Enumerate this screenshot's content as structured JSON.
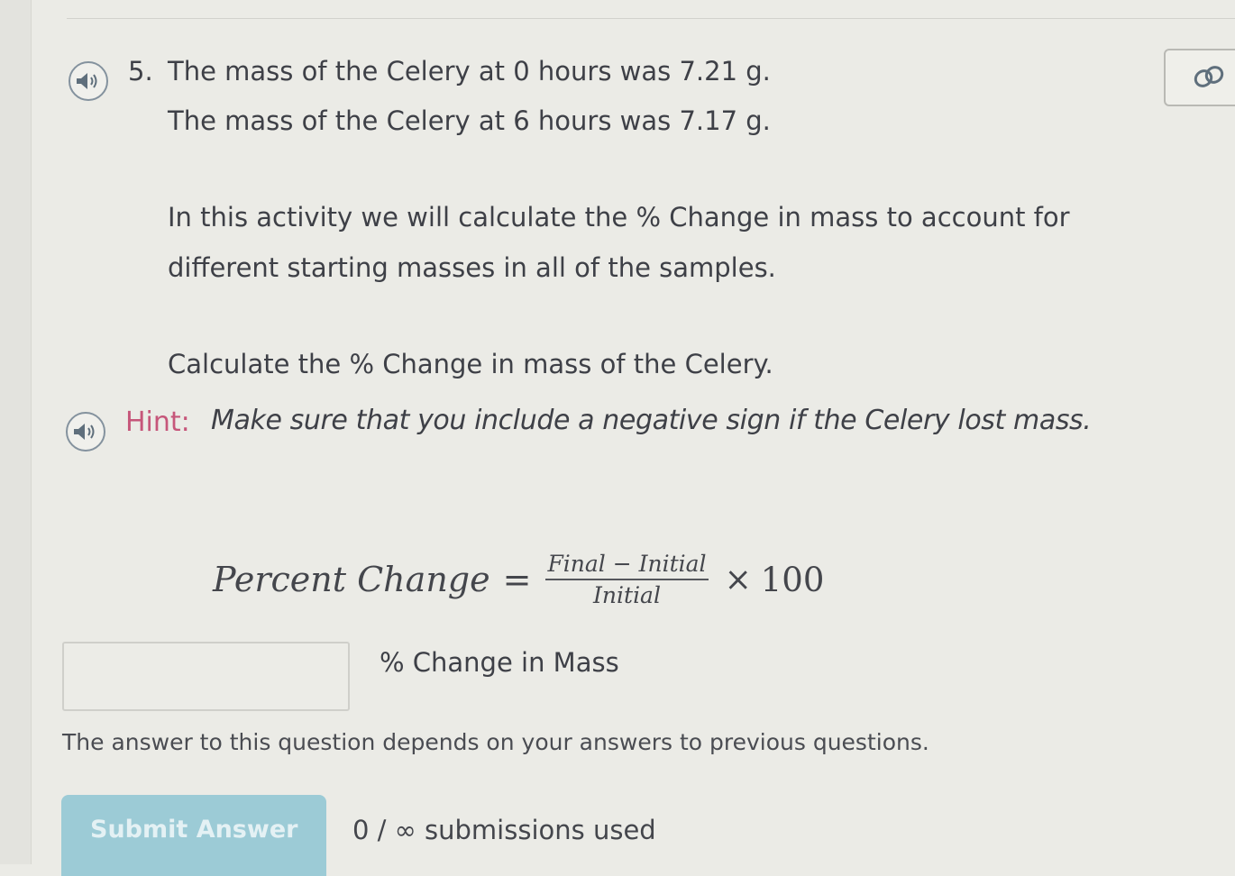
{
  "question": {
    "number": "5.",
    "lines": [
      "The mass of the Celery at 0 hours was 7.21 g.",
      "The mass of the Celery at 6 hours was 7.17 g."
    ],
    "paragraph_1": "In this activity we will calculate the % Change in mass to account for",
    "paragraph_2": "different starting masses in all of the samples.",
    "instruction": "Calculate the % Change in mass of the Celery."
  },
  "hint": {
    "label": "Hint:",
    "text": "Make sure that you include a negative sign if the Celery lost mass."
  },
  "formula": {
    "lhs": "Percent Change",
    "equals": "=",
    "numerator": "Final − Initial",
    "denominator": "Initial",
    "times": "×",
    "multiplier": "100"
  },
  "answer": {
    "value": "",
    "placeholder": "",
    "unit_label": "% Change in Mass"
  },
  "note": "The answer to this question depends on your answers to previous questions.",
  "submit": {
    "label": "Submit Answer",
    "submissions_text": "0 / ∞ submissions used"
  },
  "icons": {
    "read_aloud": "speaker-icon",
    "link": "link-icon"
  },
  "colors": {
    "hint_label": "#c6567a",
    "submit_bg": "#9ccbd6",
    "speaker_ring": "#84929e"
  }
}
